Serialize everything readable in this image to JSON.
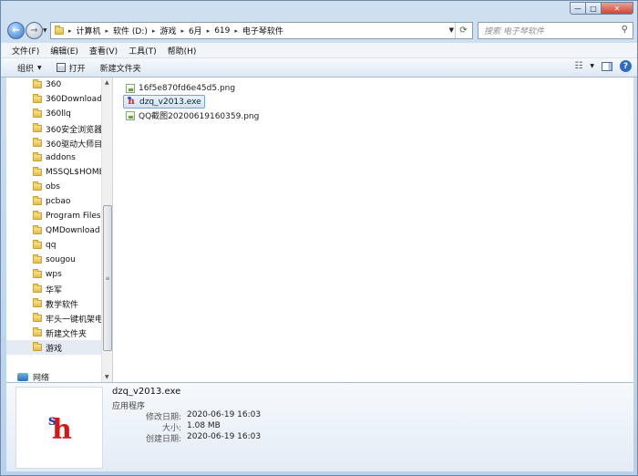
{
  "window": {
    "minimize": "—",
    "maximize": "□",
    "close": "✕"
  },
  "address": {
    "crumbs": [
      "计算机",
      "软件 (D:)",
      "游戏",
      "6月",
      "619",
      "电子琴软件"
    ]
  },
  "search": {
    "placeholder": "搜索 电子琴软件"
  },
  "menu": [
    "文件(F)",
    "编辑(E)",
    "查看(V)",
    "工具(T)",
    "帮助(H)"
  ],
  "commands": {
    "organize": "组织",
    "open": "打开",
    "new_folder": "新建文件夹"
  },
  "nav": {
    "items": [
      "360",
      "360Downloads",
      "360llq",
      "360安全浏览器下",
      "360驱动大师目录",
      "addons",
      "MSSQL$HOME",
      "obs",
      "pcbao",
      "Program Files (",
      "QMDownload",
      "qq",
      "sougou",
      "wps",
      "华军",
      "教学软件",
      "牢头一键机架电脑",
      "新建文件夹",
      "游戏"
    ],
    "selected_index": 18,
    "network": "网络"
  },
  "files": [
    {
      "name": "16f5e870fd6e45d5.png",
      "type": "png"
    },
    {
      "name": "dzq_v2013.exe",
      "type": "exe",
      "selected": true
    },
    {
      "name": "QQ截图20200619160359.png",
      "type": "png"
    }
  ],
  "details": {
    "name": "dzq_v2013.exe",
    "type": "应用程序",
    "rows": [
      {
        "key": "修改日期:",
        "value": "2020-06-19 16:03"
      },
      {
        "key": "大小:",
        "value": "1.08 MB"
      },
      {
        "key": "创建日期:",
        "value": "2020-06-19 16:03"
      }
    ]
  },
  "icons": {
    "back": "back-arrow-icon",
    "forward": "forward-arrow-icon",
    "refresh": "refresh-icon",
    "search": "search-icon",
    "views": "views-icon",
    "preview_pane": "preview-pane-icon",
    "help": "help-icon"
  }
}
